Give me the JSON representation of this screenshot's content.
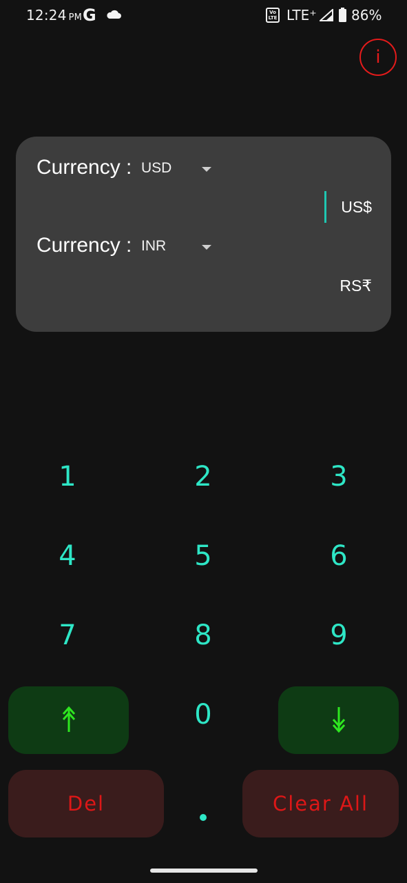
{
  "status_bar": {
    "time": "12:24",
    "ampm": "PM",
    "google_letter": "G",
    "volte": "Vo LTE",
    "network": "LTE⁺",
    "battery_pct": "86%",
    "battery_level": 0.86
  },
  "info_button": {
    "label": "i",
    "color": "#e41b1b"
  },
  "converter": {
    "from": {
      "label": "Currency :",
      "currency": "USD",
      "amount_symbol": "US$"
    },
    "to": {
      "label": "Currency :",
      "currency": "INR",
      "amount_symbol": "RS₹"
    }
  },
  "keypad": {
    "digits": [
      "1",
      "2",
      "3",
      "4",
      "5",
      "6",
      "7",
      "8",
      "9",
      "0"
    ],
    "decimal": ".",
    "swap_up_icon": "arrow-up-icon",
    "swap_down_icon": "arrow-down-icon",
    "delete_label": "Del",
    "clear_label": "Clear All"
  },
  "colors": {
    "background": "#121212",
    "card": "#3d3d3d",
    "digit": "#2ee6c6",
    "arrow_button": "#0e3b14",
    "arrow_icon": "#2ee620",
    "action_button": "#3a1c1c",
    "action_text": "#dd1717"
  }
}
